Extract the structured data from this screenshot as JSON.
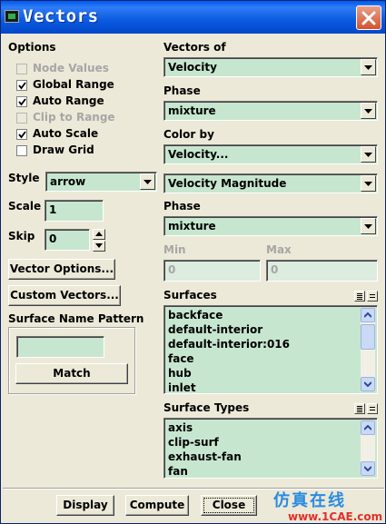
{
  "window": {
    "title": "Vectors"
  },
  "options": {
    "heading": "Options",
    "items": [
      {
        "label": "Node Values",
        "checked": false,
        "enabled": false
      },
      {
        "label": "Global Range",
        "checked": true,
        "enabled": true
      },
      {
        "label": "Auto Range",
        "checked": true,
        "enabled": true
      },
      {
        "label": "Clip to Range",
        "checked": false,
        "enabled": false
      },
      {
        "label": "Auto Scale",
        "checked": true,
        "enabled": true
      },
      {
        "label": "Draw Grid",
        "checked": false,
        "enabled": true
      }
    ]
  },
  "style": {
    "label": "Style",
    "value": "arrow"
  },
  "scale": {
    "label": "Scale",
    "value": "1"
  },
  "skip": {
    "label": "Skip",
    "value": "0"
  },
  "buttons": {
    "vector_options": "Vector Options...",
    "custom_vectors": "Custom Vectors...",
    "match": "Match",
    "display": "Display",
    "compute": "Compute",
    "close": "Close"
  },
  "surface_name_pattern": {
    "label": "Surface Name Pattern",
    "value": ""
  },
  "vectors_of": {
    "label": "Vectors of",
    "value": "Velocity"
  },
  "phase1": {
    "label": "Phase",
    "value": "mixture"
  },
  "color_by": {
    "label": "Color by",
    "value": "Velocity...",
    "sub_value": "Velocity Magnitude"
  },
  "phase2": {
    "label": "Phase",
    "value": "mixture"
  },
  "min": {
    "label": "Min",
    "value": "0"
  },
  "max": {
    "label": "Max",
    "value": "0"
  },
  "surfaces": {
    "label": "Surfaces",
    "items": [
      "backface",
      "default-interior",
      "default-interior:016",
      "face",
      "hub",
      "inlet"
    ]
  },
  "surface_types": {
    "label": "Surface Types",
    "items": [
      "axis",
      "clip-surf",
      "exhaust-fan",
      "fan"
    ]
  },
  "watermark": {
    "text": "仿真在线",
    "url": "www.1CAE.com"
  },
  "colors": {
    "field_bg": "#c7e6cf",
    "panel_bg": "#ece9d8",
    "title_blue": "#0a5ae0",
    "close_red": "#d2542f"
  }
}
